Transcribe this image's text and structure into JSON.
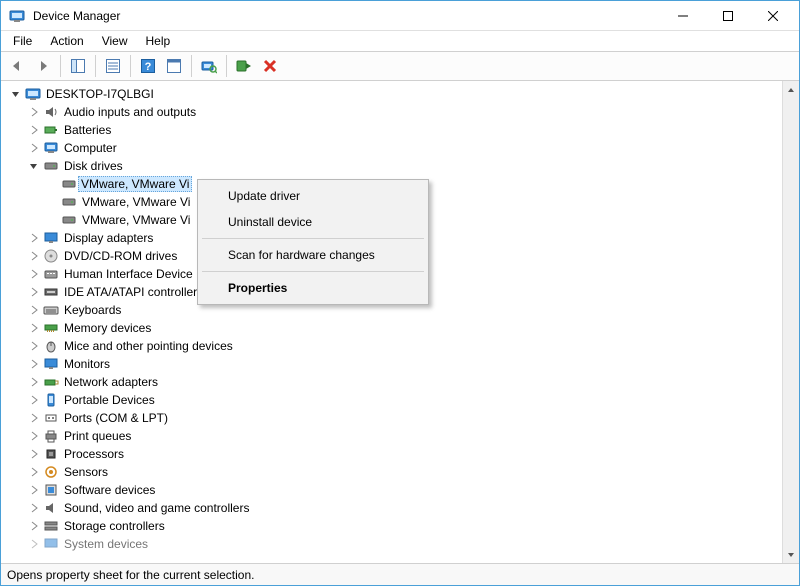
{
  "window": {
    "title": "Device Manager"
  },
  "menubar": {
    "file": "File",
    "action": "Action",
    "view": "View",
    "help": "Help"
  },
  "tree": {
    "root_label": "DESKTOP-I7QLBGI",
    "audio": "Audio inputs and outputs",
    "batteries": "Batteries",
    "computer": "Computer",
    "disk_drives": "Disk drives",
    "disk1": "VMware, VMware Vi",
    "disk2": "VMware, VMware Vi",
    "disk3": "VMware, VMware Vi",
    "display_adapters": "Display adapters",
    "dvd": "DVD/CD-ROM drives",
    "hid": "Human Interface Device",
    "ide": "IDE ATA/ATAPI controllers",
    "keyboards": "Keyboards",
    "memory": "Memory devices",
    "mice": "Mice and other pointing devices",
    "monitors": "Monitors",
    "network": "Network adapters",
    "portable": "Portable Devices",
    "ports": "Ports (COM & LPT)",
    "print_queues": "Print queues",
    "processors": "Processors",
    "sensors": "Sensors",
    "software_devices": "Software devices",
    "sound": "Sound, video and game controllers",
    "storage": "Storage controllers",
    "system_devices": "System devices"
  },
  "context_menu": {
    "update_driver": "Update driver",
    "uninstall": "Uninstall device",
    "scan": "Scan for hardware changes",
    "properties": "Properties"
  },
  "statusbar": {
    "text": "Opens property sheet for the current selection."
  }
}
